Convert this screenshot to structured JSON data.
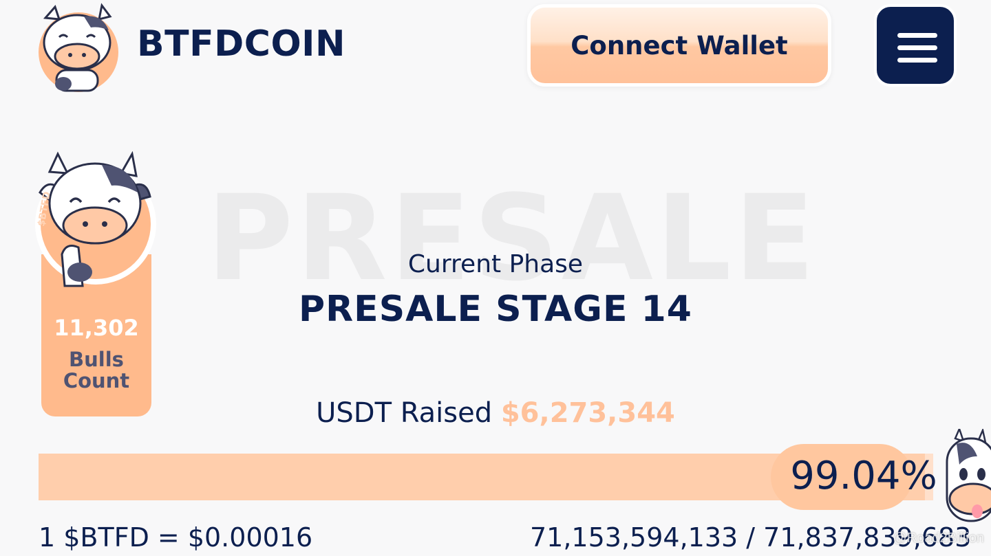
{
  "header": {
    "brand": "BTFDCOIN",
    "connect_label": "Connect Wallet",
    "logo_icon": "cow-mascot-icon",
    "menu_icon": "hamburger-menu-icon"
  },
  "bulls": {
    "count": "11,302",
    "label": "Bulls Count",
    "badge_text": "$BTFD"
  },
  "presale": {
    "watermark": "PRESALE",
    "phase_label": "Current Phase",
    "stage": "PRESALE STAGE 14",
    "raised_label": "USDT Raised",
    "raised_amount": "$6,273,344",
    "progress_fraction": 0.9904,
    "progress_text": "99.04%",
    "price": "1 $BTFD = $0.00016",
    "tokens": "71,153,594,133 / 71,837,839,683"
  },
  "credit": "@Road2Billion",
  "colors": {
    "navy": "#0c1f4f",
    "peach": "#ffba8c",
    "peach_light": "#ffe0cb",
    "background": "#f8f8f9"
  }
}
